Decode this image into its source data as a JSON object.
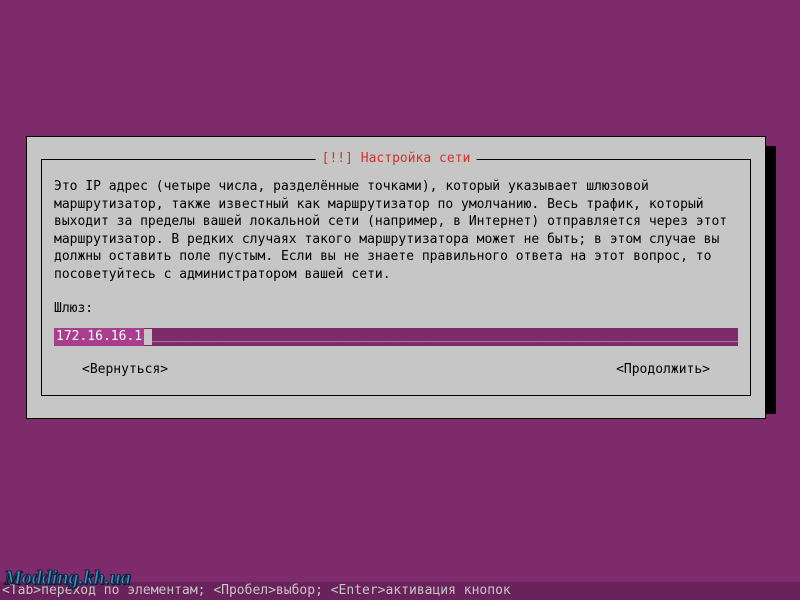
{
  "dialog": {
    "title": "[!!] Настройка сети",
    "description": "Это IP адрес (четыре числа, разделённые точками), который указывает шлюзовой маршрутизатор, также известный как маршрутизатор по умолчанию. Весь трафик, который выходит за пределы вашей локальной сети (например, в Интернет) отправляется через этот маршрутизатор. В редких случаях такого маршрутизатора может не быть; в этом случае вы должны оставить поле пустым. Если вы не знаете правильного ответа на этот вопрос, то посоветуйтесь с администратором вашей сети.",
    "field_label": "Шлюз:",
    "input_value": "172.16.16.1",
    "back_label": "<Вернуться>",
    "continue_label": "<Продолжить>"
  },
  "helpbar": "<Tab>переход по элементам; <Пробел>выбор; <Enter>активация кнопок",
  "watermark": "Modding.kh.ua"
}
